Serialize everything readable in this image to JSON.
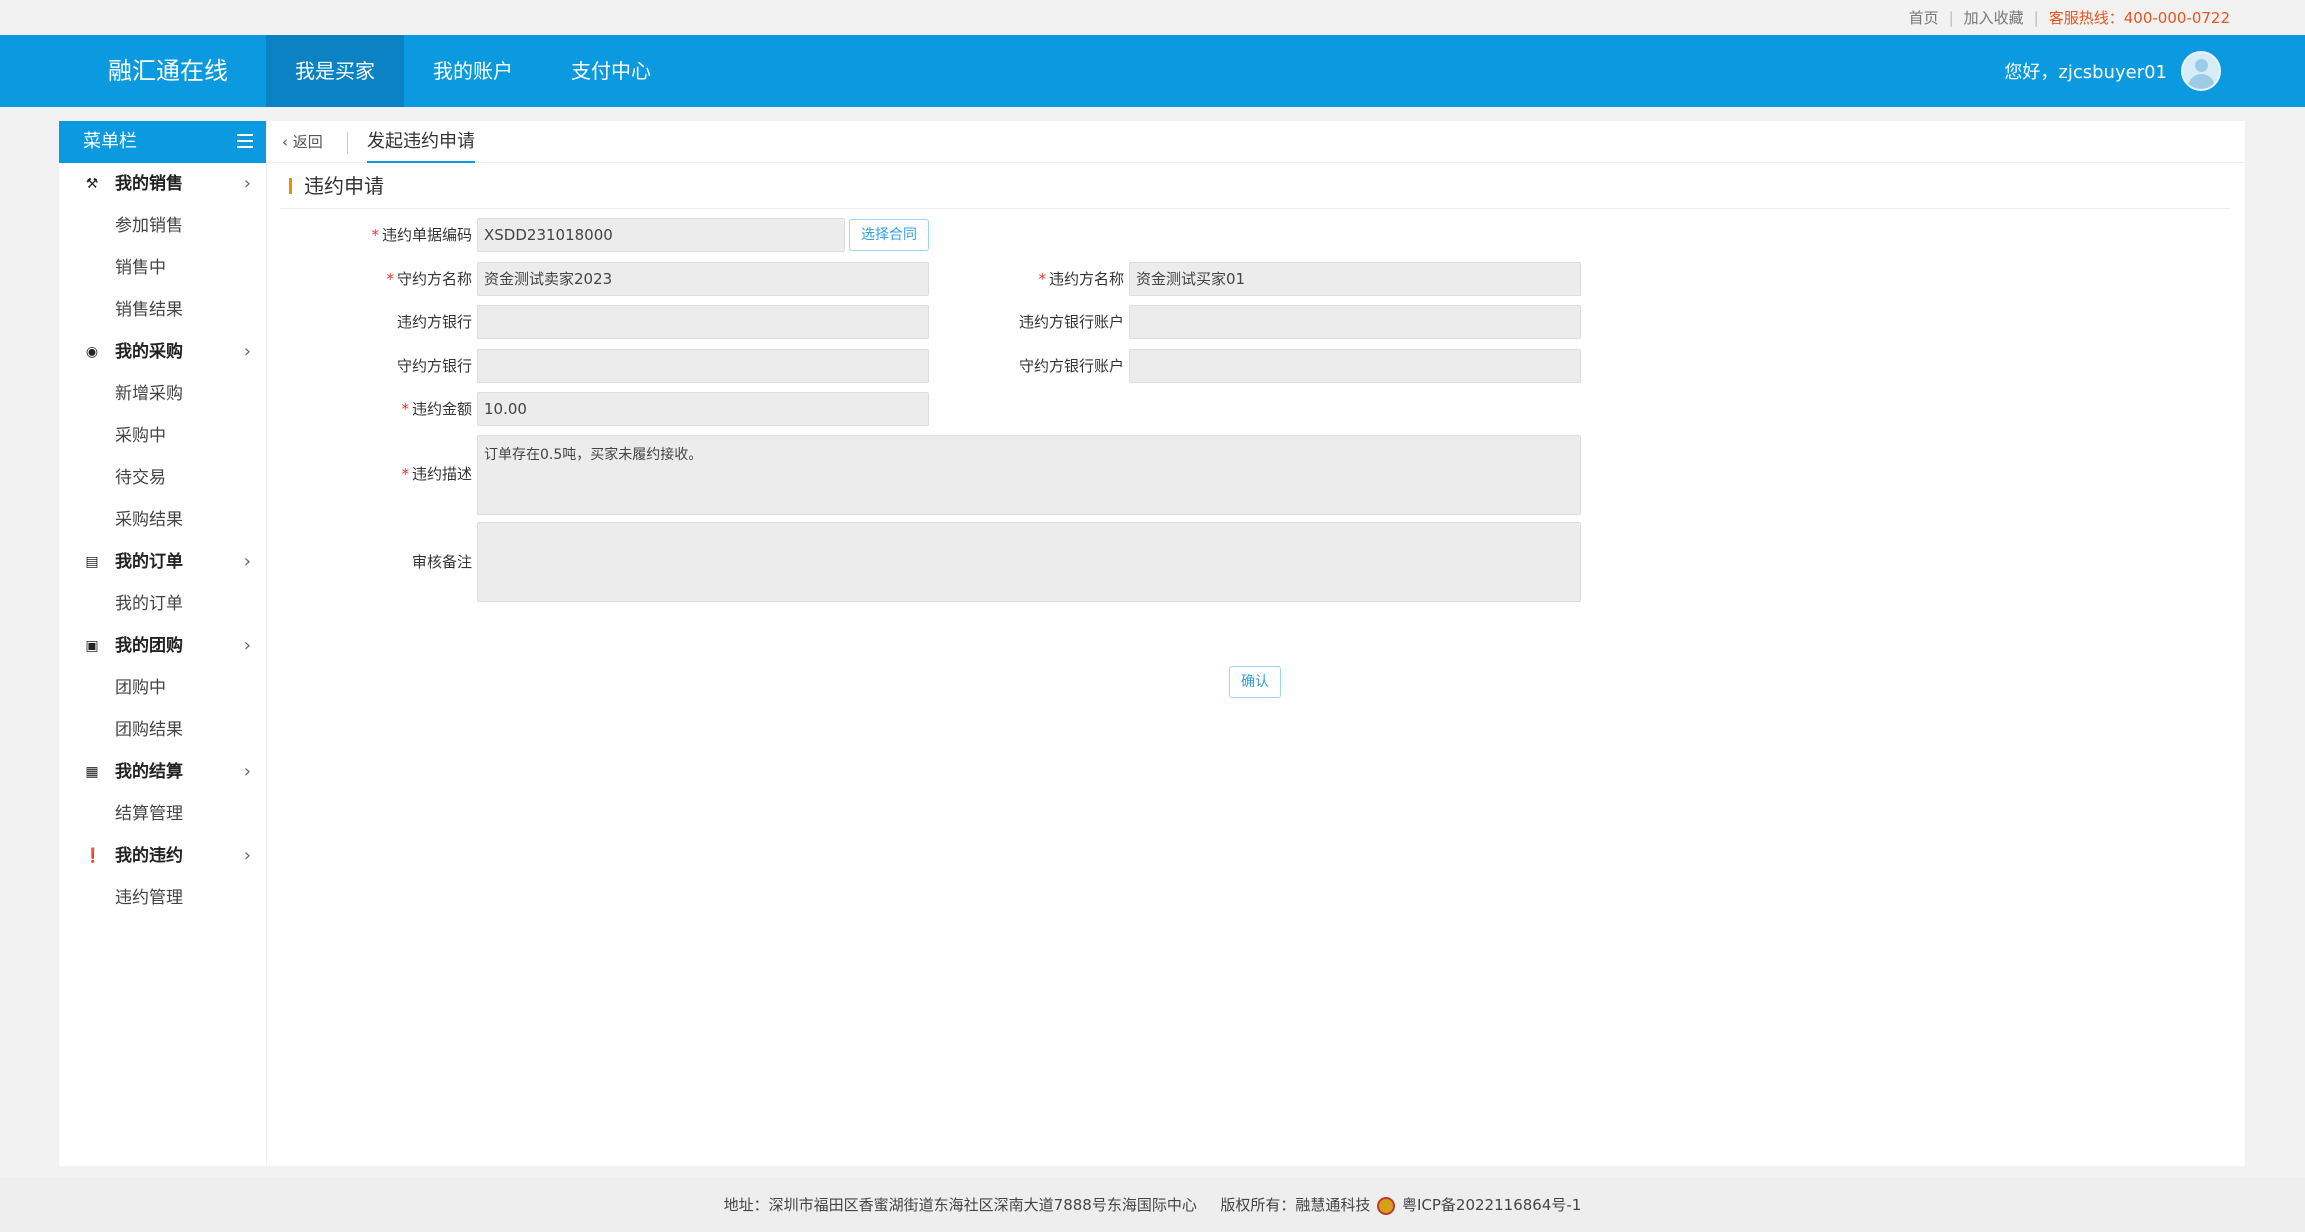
{
  "topbar": {
    "home": "首页",
    "favorite": "加入收藏",
    "hotline": "客服热线：400-000-0722"
  },
  "header": {
    "logo": "融汇通在线",
    "nav": [
      "我是买家",
      "我的账户",
      "支付中心"
    ],
    "greeting": "您好，zjcsbuyer01"
  },
  "sidebar": {
    "title": "菜单栏",
    "groups": [
      {
        "label": "我的销售",
        "items": [
          "参加销售",
          "销售中",
          "销售结果"
        ]
      },
      {
        "label": "我的采购",
        "items": [
          "新增采购",
          "采购中",
          "待交易",
          "采购结果"
        ]
      },
      {
        "label": "我的订单",
        "items": [
          "我的订单"
        ]
      },
      {
        "label": "我的团购",
        "items": [
          "团购中",
          "团购结果"
        ]
      },
      {
        "label": "我的结算",
        "items": [
          "结算管理"
        ]
      },
      {
        "label": "我的违约",
        "items": [
          "违约管理"
        ]
      }
    ]
  },
  "tabs": {
    "back": "返回",
    "current": "发起违约申请"
  },
  "section": {
    "title": "违约申请"
  },
  "form": {
    "doc_no": {
      "label": "违约单据编码",
      "value": "XSDD231018000"
    },
    "select_contract": "选择合同",
    "keeper_name": {
      "label": "守约方名称",
      "value": "资金测试卖家2023"
    },
    "breacher_name": {
      "label": "违约方名称",
      "value": "资金测试买家01"
    },
    "breacher_bank": {
      "label": "违约方银行",
      "value": ""
    },
    "breacher_account": {
      "label": "违约方银行账户",
      "value": ""
    },
    "keeper_bank": {
      "label": "守约方银行",
      "value": ""
    },
    "keeper_account": {
      "label": "守约方银行账户",
      "value": ""
    },
    "amount": {
      "label": "违约金额",
      "value": "10.00"
    },
    "description": {
      "label": "违约描述",
      "value": "订单存在0.5吨，买家未履约接收。"
    },
    "review_note": {
      "label": "审核备注",
      "value": ""
    },
    "confirm": "确认"
  },
  "footer": {
    "address": "地址：深圳市福田区香蜜湖街道东海社区深南大道7888号东海国际中心",
    "copyright": "版权所有：融慧通科技",
    "icp": "粤ICP备2022116864号-1"
  }
}
